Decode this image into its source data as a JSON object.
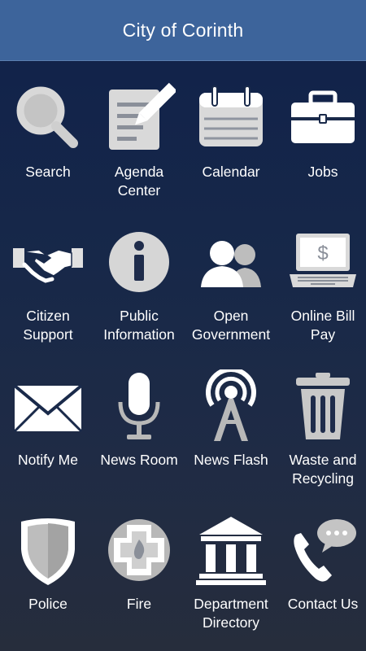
{
  "header": {
    "title": "City of Corinth"
  },
  "tiles": [
    {
      "label": "Search",
      "icon": "search-icon"
    },
    {
      "label": "Agenda\nCenter",
      "icon": "agenda-icon"
    },
    {
      "label": "Calendar",
      "icon": "calendar-icon"
    },
    {
      "label": "Jobs",
      "icon": "briefcase-icon"
    },
    {
      "label": "Citizen\nSupport",
      "icon": "handshake-icon"
    },
    {
      "label": "Public\nInformation",
      "icon": "info-icon"
    },
    {
      "label": "Open\nGovernment",
      "icon": "people-icon"
    },
    {
      "label": "Online Bill\nPay",
      "icon": "laptop-dollar-icon"
    },
    {
      "label": "Notify Me",
      "icon": "envelope-icon"
    },
    {
      "label": "News Room",
      "icon": "microphone-icon"
    },
    {
      "label": "News Flash",
      "icon": "radio-tower-icon"
    },
    {
      "label": "Waste and\nRecycling",
      "icon": "trash-can-icon"
    },
    {
      "label": "Police",
      "icon": "shield-icon"
    },
    {
      "label": "Fire",
      "icon": "fire-badge-icon"
    },
    {
      "label": "Department\nDirectory",
      "icon": "building-icon"
    },
    {
      "label": "Contact Us",
      "icon": "phone-chat-icon"
    }
  ],
  "icon_dollar": "$",
  "colors": {
    "header": "#3d649b",
    "icon": "#ffffff",
    "icon_gray": "#b8b8b8"
  }
}
